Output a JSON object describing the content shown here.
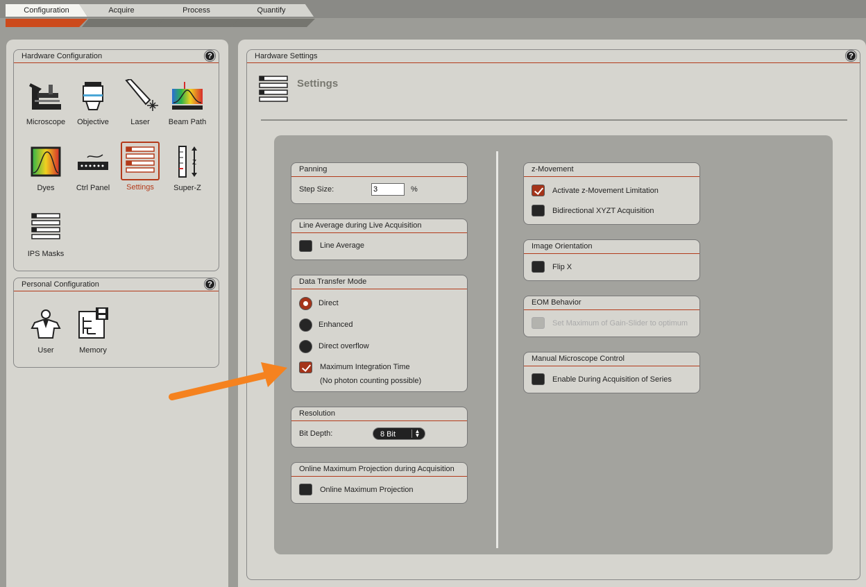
{
  "tabs": [
    {
      "label": "Configuration"
    },
    {
      "label": "Acquire"
    },
    {
      "label": "Process"
    },
    {
      "label": "Quantify"
    }
  ],
  "hardware_config": {
    "title": "Hardware Configuration",
    "help": "?",
    "items": [
      {
        "label": "Microscope",
        "icon": "microscope-icon"
      },
      {
        "label": "Objective",
        "icon": "objective-icon"
      },
      {
        "label": "Laser",
        "icon": "laser-icon"
      },
      {
        "label": "Beam Path",
        "icon": "beam-path-icon"
      },
      {
        "label": "Dyes",
        "icon": "dyes-icon"
      },
      {
        "label": "Ctrl Panel",
        "icon": "ctrl-panel-icon"
      },
      {
        "label": "Settings",
        "icon": "settings-icon"
      },
      {
        "label": "Super-Z",
        "icon": "super-z-icon"
      },
      {
        "label": "IPS Masks",
        "icon": "ips-masks-icon"
      }
    ]
  },
  "personal_config": {
    "title": "Personal Configuration",
    "help": "?",
    "items": [
      {
        "label": "User",
        "icon": "user-icon"
      },
      {
        "label": "Memory",
        "icon": "memory-icon"
      }
    ]
  },
  "hardware_settings": {
    "title": "Hardware Settings",
    "help": "?",
    "heading": "Settings"
  },
  "panning": {
    "title": "Panning",
    "step_label": "Step Size:",
    "step_value": "3",
    "unit": "%"
  },
  "line_average": {
    "title": "Line Average during Live Acquisition",
    "option": "Line Average",
    "checked": false
  },
  "data_transfer": {
    "title": "Data Transfer Mode",
    "options": [
      {
        "label": "Direct",
        "selected": true
      },
      {
        "label": "Enhanced",
        "selected": false
      },
      {
        "label": "Direct overflow",
        "selected": false
      }
    ],
    "max_integration": "Maximum Integration Time",
    "max_integration_note": "(No photon counting possible)",
    "max_integration_checked": true
  },
  "resolution": {
    "title": "Resolution",
    "label": "Bit Depth:",
    "value": "8 Bit"
  },
  "online_max": {
    "title": "Online Maximum Projection during Acquisition",
    "option": "Online Maximum Projection",
    "checked": false
  },
  "z_movement": {
    "title": "z-Movement",
    "opt1": "Activate z-Movement Limitation",
    "opt1_checked": true,
    "opt2": "Bidirectional XYZT Acquisition",
    "opt2_checked": false
  },
  "image_orientation": {
    "title": "Image Orientation",
    "option": "Flip X",
    "checked": false
  },
  "eom": {
    "title": "EOM Behavior",
    "option": "Set Maximum of Gain-Slider to optimum",
    "checked": false,
    "disabled": true
  },
  "manual_microscope": {
    "title": "Manual Microscope Control",
    "option": "Enable During Acquisition of Series",
    "checked": false
  },
  "colors": {
    "accent": "#b33a1a",
    "arrow": "#f5821f"
  }
}
